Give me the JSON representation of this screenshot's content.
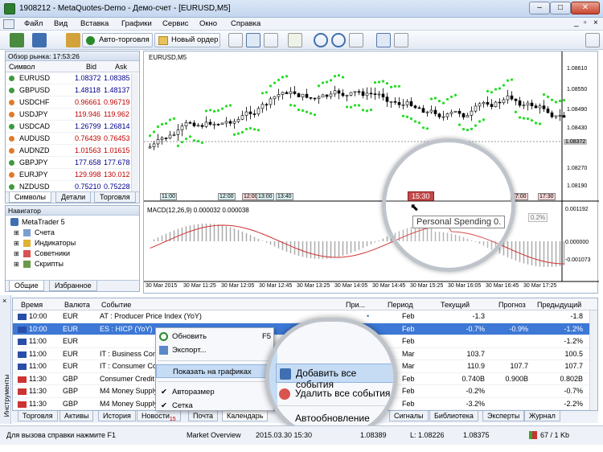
{
  "window": {
    "title": "1908212 - MetaQuotes-Demo - Демо-счет - [EURUSD,M5]"
  },
  "menu": [
    "Файл",
    "Вид",
    "Вставка",
    "Графики",
    "Сервис",
    "Окно",
    "Справка"
  ],
  "toolbar": {
    "autotrade": "Авто-торговля",
    "neworder": "Новый ордер"
  },
  "market": {
    "title": "Обзор рынка: 17:53:26",
    "headers": [
      "Символ",
      "Bid",
      "Ask"
    ],
    "rows": [
      {
        "s": "EURUSD",
        "b": "1.08372",
        "a": "1.08385",
        "c": "#00008b"
      },
      {
        "s": "GBPUSD",
        "b": "1.48118",
        "a": "1.48137",
        "c": "#00008b"
      },
      {
        "s": "USDCHF",
        "b": "0.96661",
        "a": "0.96719",
        "c": "#c00000"
      },
      {
        "s": "USDJPY",
        "b": "119.946",
        "a": "119.962",
        "c": "#c00000"
      },
      {
        "s": "USDCAD",
        "b": "1.26799",
        "a": "1.26814",
        "c": "#00008b"
      },
      {
        "s": "AUDUSD",
        "b": "0.76439",
        "a": "0.76453",
        "c": "#c00000"
      },
      {
        "s": "AUDNZD",
        "b": "1.01563",
        "a": "1.01615",
        "c": "#c00000"
      },
      {
        "s": "GBPJPY",
        "b": "177.658",
        "a": "177.678",
        "c": "#00008b"
      },
      {
        "s": "EURJPY",
        "b": "129.998",
        "a": "130.012",
        "c": "#c00000"
      },
      {
        "s": "NZDUSD",
        "b": "0.75210",
        "a": "0.75228",
        "c": "#00008b"
      }
    ],
    "tabs": [
      "Символы",
      "Детали",
      "Торговля"
    ]
  },
  "navigator": {
    "title": "Навигатор",
    "root": "MetaTrader 5",
    "items": [
      "Счета",
      "Индикаторы",
      "Советники",
      "Скрипты"
    ],
    "tabs": [
      "Общие",
      "Избранное"
    ]
  },
  "chart": {
    "symbol": "EURUSD,M5",
    "price_labels": [
      "1.08610",
      "1.08550",
      "1.08490",
      "1.08430",
      "1.08372",
      "1.08270",
      "1.08190"
    ],
    "time_axis": [
      "30 Mar 2015",
      "30 Mar 11:25",
      "30 Mar 12:05",
      "30 Mar 12:45",
      "30 Mar 13:25",
      "30 Mar 14:05",
      "30 Mar 14:45",
      "30 Mar 15:25",
      "30 Mar 16:05",
      "30 Mar 16:45",
      "30 Mar 17:25"
    ],
    "event_labels": [
      "11:00",
      "12:00",
      "12:00",
      "13:00",
      "13:40",
      "15:30",
      "17:00",
      "17:30"
    ],
    "macd_title": "MACD(12,26,9) 0.000032 0.000038",
    "macd_levels": [
      "0.001192",
      "0.000000",
      "-0.001073"
    ],
    "tooltip": "Personal Spending 0.",
    "tooltip_extra": "0.2%"
  },
  "calendar": {
    "headers": [
      "Время",
      "Валюта",
      "Событие",
      "При...",
      "Период",
      "Текущий",
      "Прогноз",
      "Предыдущий"
    ],
    "rows": [
      {
        "time": "10:00",
        "cur": "EUR",
        "event": "AT : Producer Price Index (YoY)",
        "pri": "•",
        "period": "Feb",
        "cur_v": "-1.3",
        "fc": "",
        "prev": "-1.8"
      },
      {
        "time": "10:00",
        "cur": "EUR",
        "event": "ES : HICP (YoY)",
        "pri": "",
        "period": "Feb",
        "cur_v": "-0.7%",
        "fc": "-0.9%",
        "prev": "-1.2%",
        "sel": true
      },
      {
        "time": "11:00",
        "cur": "EUR",
        "event": "",
        "pri": "",
        "period": "Feb",
        "cur_v": "",
        "fc": "",
        "prev": "-1.2%"
      },
      {
        "time": "11:00",
        "cur": "EUR",
        "event": "IT : Business Conf",
        "pri": "•",
        "period": "Mar",
        "cur_v": "103.7",
        "fc": "",
        "prev": "100.5"
      },
      {
        "time": "11:00",
        "cur": "EUR",
        "event": "IT : Consumer Co",
        "pri": "",
        "period": "Mar",
        "cur_v": "110.9",
        "fc": "107.7",
        "prev": "107.7"
      },
      {
        "time": "11:30",
        "cur": "GBP",
        "event": "Consumer Credit",
        "pri": "",
        "period": "Feb",
        "cur_v": "0.740B",
        "fc": "0.900B",
        "prev": "0.802B"
      },
      {
        "time": "11:30",
        "cur": "GBP",
        "event": "M4 Money Supply",
        "pri": "",
        "period": "Feb",
        "cur_v": "-0.2%",
        "fc": "",
        "prev": "-0.7%"
      },
      {
        "time": "11:30",
        "cur": "GBP",
        "event": "M4 Money Supply",
        "pri": "",
        "period": "Feb",
        "cur_v": "-3.2%",
        "fc": "",
        "prev": "-2.2%"
      }
    ],
    "tabs": [
      "Торговля",
      "Активы",
      "История",
      "Новости",
      "Почта",
      "Календарь",
      "Сигналы",
      "Библиотека",
      "Эксперты",
      "Журнал"
    ],
    "news_count": "15",
    "side_label": "Инструменты"
  },
  "context_menu": {
    "items": [
      "Обновить",
      "Экспорт...",
      "Показать на графиках",
      "Авторазмер",
      "Сетка"
    ],
    "shortcut": "F5",
    "submenu": [
      "Добавить все события",
      "Удалить все события",
      "Автообновление"
    ]
  },
  "status": {
    "help": "Для вызова справки нажмите F1",
    "profile": "Market Overview",
    "time": "2015.03.30 15:30",
    "o": "1.08389",
    "l": "L: 1.08226",
    "c": "1.08375",
    "traffic": "67 / 1 Kb"
  }
}
